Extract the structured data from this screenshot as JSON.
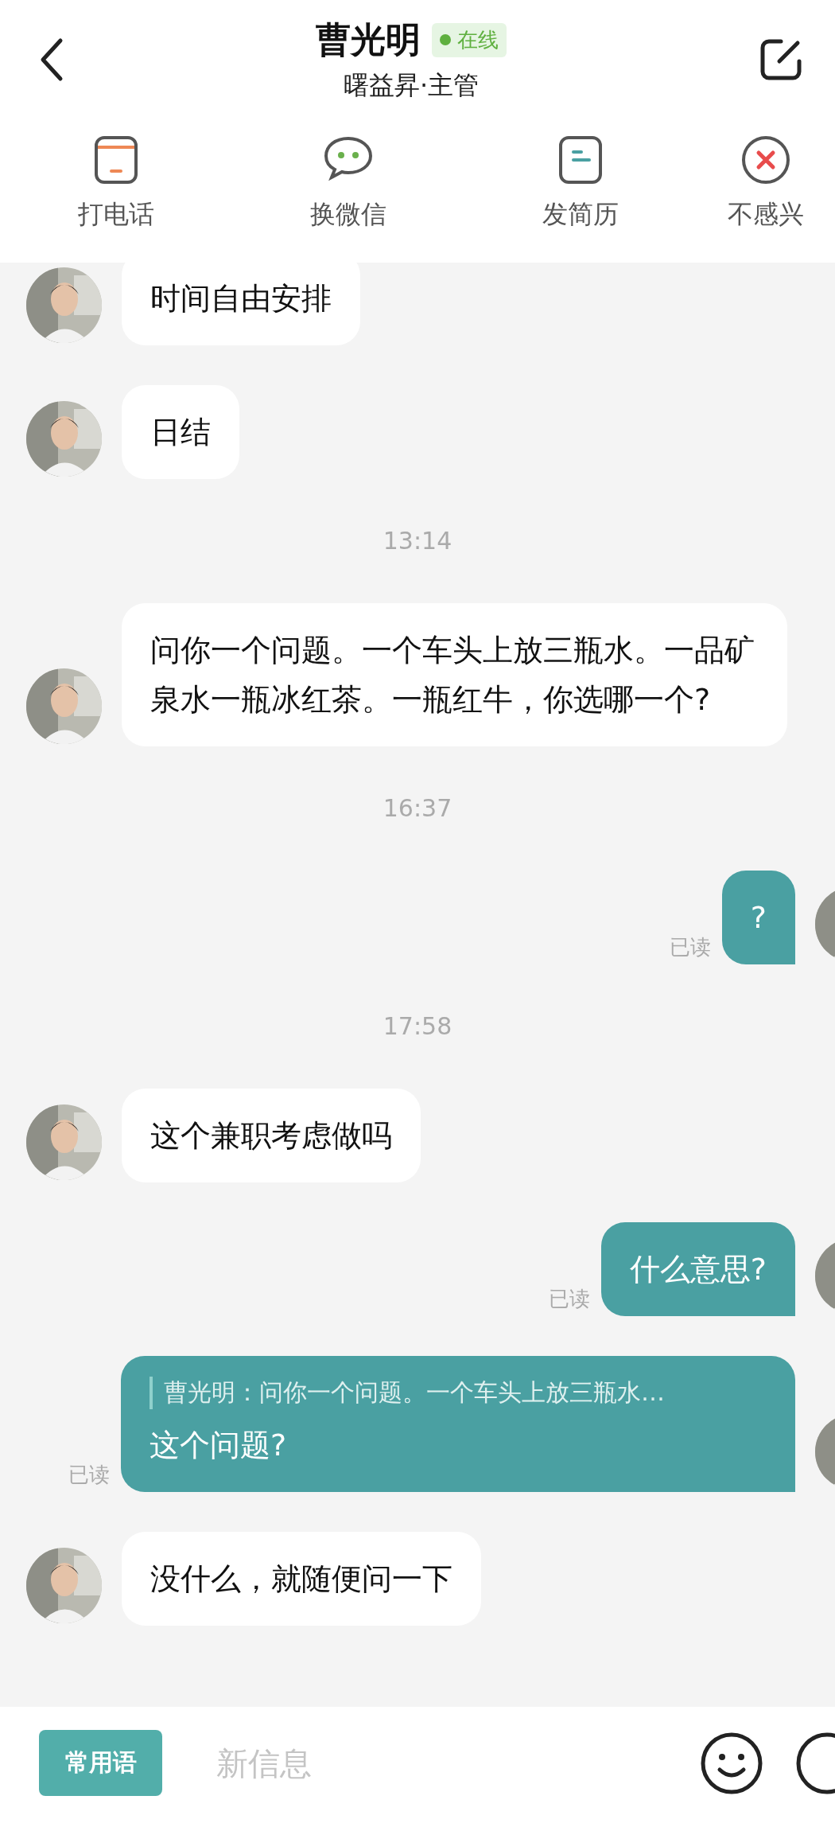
{
  "header": {
    "name": "曹光明",
    "status_badge": "在线",
    "subtitle": "曙益昇·主管"
  },
  "actions": [
    {
      "kind": "phone",
      "label": "打电话"
    },
    {
      "kind": "wechat",
      "label": "换微信"
    },
    {
      "kind": "resume",
      "label": "发简历"
    },
    {
      "kind": "reject",
      "label": "不感兴"
    }
  ],
  "messages": [
    {
      "kind": "incoming",
      "text": "时间自由安排"
    },
    {
      "kind": "incoming",
      "text": "日结"
    },
    {
      "kind": "time",
      "text": "13:14"
    },
    {
      "kind": "incoming",
      "text": "问你一个问题。一个车头上放三瓶水。一品矿泉水一瓶冰红茶。一瓶红牛，你选哪一个?"
    },
    {
      "kind": "time",
      "text": "16:37"
    },
    {
      "kind": "outgoing",
      "text": "?",
      "status": "已读"
    },
    {
      "kind": "time",
      "text": "17:58"
    },
    {
      "kind": "incoming",
      "text": "这个兼职考虑做吗"
    },
    {
      "kind": "outgoing",
      "text": "什么意思?",
      "status": "已读"
    },
    {
      "kind": "outgoing",
      "quote": "曹光明：问你一个问题。一个车头上放三瓶水…",
      "text": "这个问题?",
      "status": "已读"
    },
    {
      "kind": "incoming",
      "text": "没什么，就随便问一下"
    }
  ],
  "input_bar": {
    "phrases_button": "常用语",
    "placeholder": "新信息"
  }
}
